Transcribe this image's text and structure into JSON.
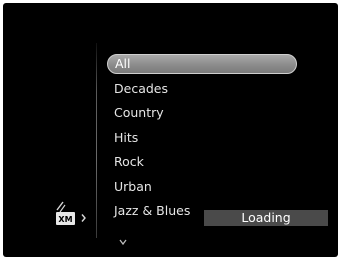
{
  "menu": {
    "items": [
      {
        "label": "All",
        "selected": true
      },
      {
        "label": "Decades",
        "selected": false
      },
      {
        "label": "Country",
        "selected": false
      },
      {
        "label": "Hits",
        "selected": false
      },
      {
        "label": "Rock",
        "selected": false
      },
      {
        "label": "Urban",
        "selected": false
      },
      {
        "label": "Jazz & Blues",
        "selected": false
      }
    ],
    "more_icon": "chevron-down-icon"
  },
  "logo": {
    "text": "XM",
    "icon": "xm-logo-icon"
  },
  "status": {
    "text": "Loading"
  },
  "colors": {
    "background": "#000000",
    "selected_highlight": "#8e8e8e",
    "text": "#e6e6e6",
    "status_bar": "#4a4a4a"
  }
}
